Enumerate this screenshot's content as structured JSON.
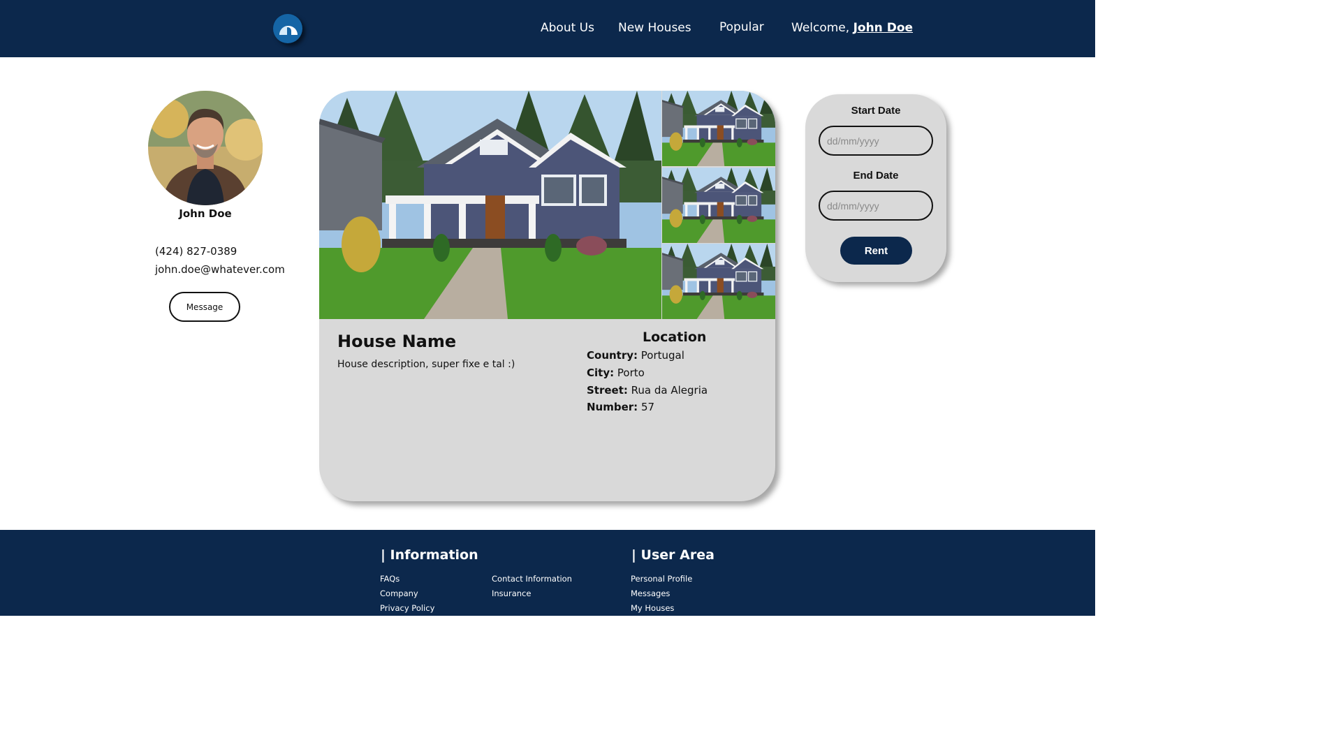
{
  "header": {
    "nav": {
      "about": "About Us",
      "new_houses": "New Houses",
      "popular": "Popular",
      "welcome_prefix": "Welcome,",
      "user_link": "John Doe"
    }
  },
  "profile": {
    "name": "John Doe",
    "phone": "(424) 827-0389",
    "email": "john.doe@whatever.com",
    "message_button": "Message"
  },
  "house": {
    "name": "House Name",
    "description": "House description, super fixe e tal :)",
    "location": {
      "title": "Location",
      "country_label": "Country:",
      "country": "Portugal",
      "city_label": "City:",
      "city": "Porto",
      "street_label": "Street:",
      "street": "Rua da Alegria",
      "number_label": "Number:",
      "number": "57"
    }
  },
  "rent_panel": {
    "start_label": "Start Date",
    "start_placeholder": "dd/mm/yyyy",
    "end_label": "End Date",
    "end_placeholder": "dd/mm/yyyy",
    "rent_button": "Rent"
  },
  "footer": {
    "information": {
      "heading": "| Information",
      "links": [
        "FAQs",
        "Company",
        "Privacy Policy",
        "Contact Information",
        "Insurance"
      ]
    },
    "user_area": {
      "heading": "| User Area",
      "links": [
        "Personal Profile",
        "Messages",
        "My Houses"
      ]
    }
  },
  "colors": {
    "navy": "#0c284c",
    "panel_gray": "#d9d9d9",
    "logo_blue": "#1565a6"
  },
  "icons": {
    "logo": "igloo-logo-icon"
  }
}
